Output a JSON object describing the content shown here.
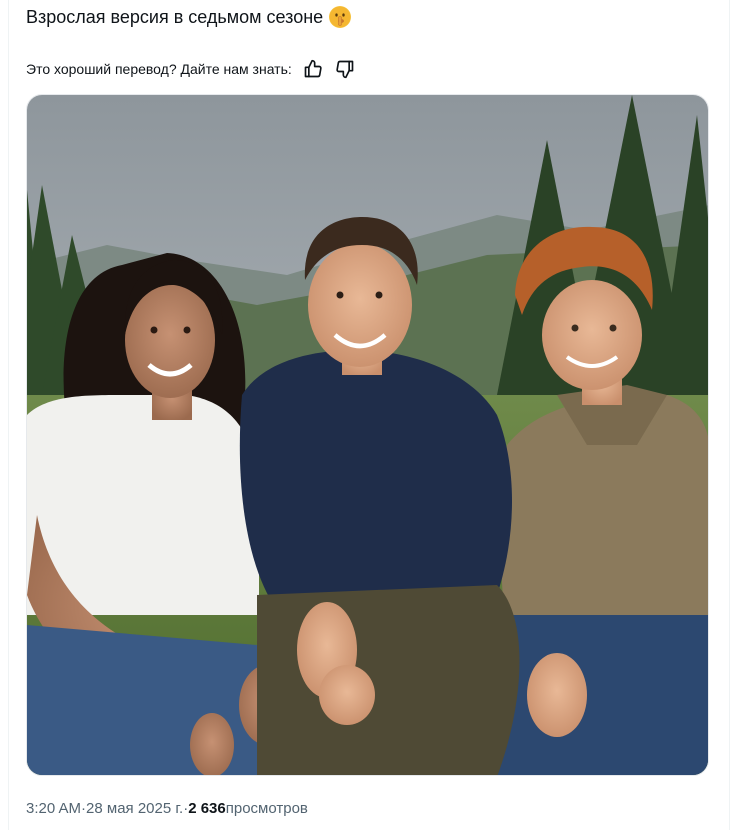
{
  "post": {
    "text": "Взрослая версия в седьмом сезоне",
    "emoji": "shushing-face-emoji"
  },
  "translation": {
    "prompt": "Это хороший перевод? Дайте нам знать:",
    "like_icon": "thumbs-up-icon",
    "dislike_icon": "thumbs-down-icon"
  },
  "media": {
    "type": "photo"
  },
  "meta": {
    "time": "3:20 AM",
    "separator": " · ",
    "date": "28 мая 2025 г.",
    "views_count": "2 636",
    "views_label": " просмотров"
  },
  "colors": {
    "text": "#0f1419",
    "secondary": "#536471",
    "border": "#eff3f4"
  }
}
